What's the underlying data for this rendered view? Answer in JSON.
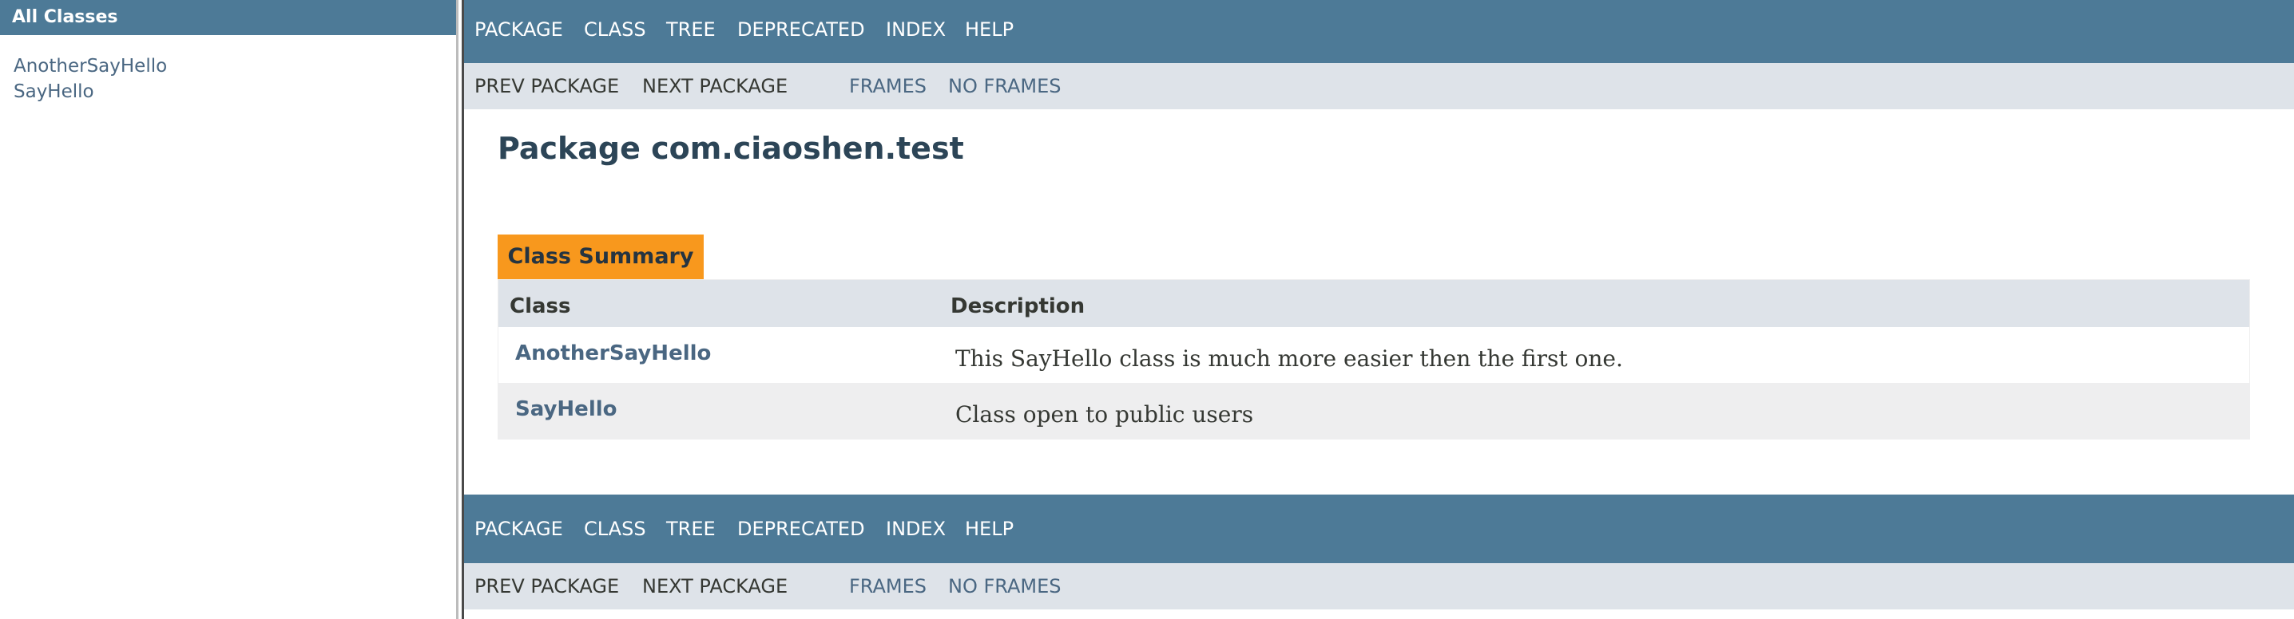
{
  "left_frame": {
    "header": "All Classes",
    "classes": [
      "AnotherSayHello",
      "SayHello"
    ]
  },
  "nav": {
    "top": [
      "PACKAGE",
      "CLASS",
      "TREE",
      "DEPRECATED",
      "INDEX",
      "HELP"
    ],
    "sub": {
      "prev_package": "PREV PACKAGE",
      "next_package": "NEXT PACKAGE",
      "frames": "FRAMES",
      "no_frames": "NO FRAMES"
    }
  },
  "main": {
    "title": "Package com.ciaoshen.test",
    "caption": "Class Summary",
    "columns": [
      "Class",
      "Description"
    ],
    "rows": [
      {
        "class": "AnotherSayHello",
        "description": "This SayHello class is much more easier then the first one."
      },
      {
        "class": "SayHello",
        "description": "Class open to public users"
      }
    ]
  },
  "colors": {
    "nav_bar": "#4d7a97",
    "sub_nav": "#dee3e9",
    "caption": "#f8981d",
    "link": "#4a6782",
    "alt_row": "#eeeeef"
  }
}
